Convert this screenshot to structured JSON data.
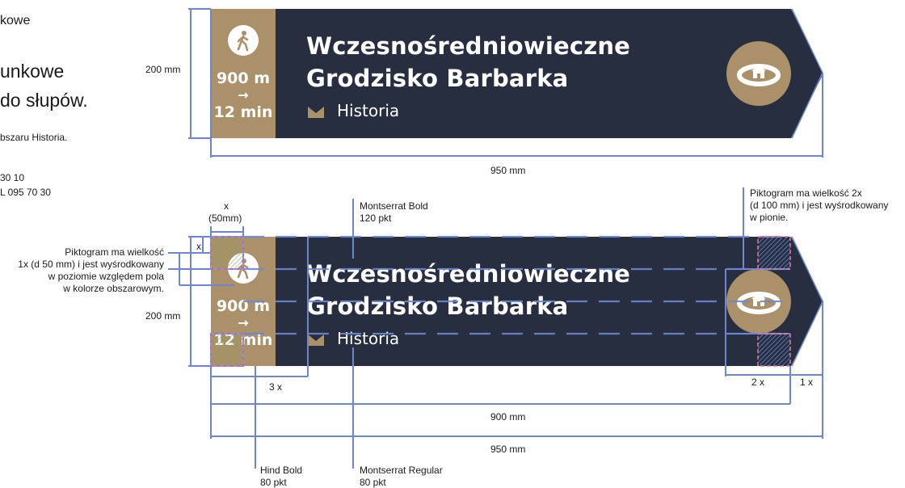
{
  "left_text": {
    "line1": "kowe",
    "line2": "unkowe",
    "line3": "do słupów.",
    "line4": "bszaru Historia.",
    "line5": "30 10",
    "line6": "L 095 70 30"
  },
  "sign": {
    "distance": "900 m",
    "arrow": "→",
    "time": "12 min",
    "title_line1": "Wczesnośredniowieczne",
    "title_line2": "Grodzisko Barbarka",
    "category": "Historia",
    "walker_icon": "pedestrian-icon",
    "category_icon": "crown-icon",
    "pictogram_icon": "fortified-settlement-icon",
    "colors": {
      "navy": "#262e40",
      "gold": "#ab9169",
      "guide": "#6e86cf",
      "margin": "#e07aa0"
    }
  },
  "annotations": {
    "height_top": "200 mm",
    "height_bottom": "200 mm",
    "width_950_top": "950 mm",
    "width_900": "900 mm",
    "width_950_bottom": "950 mm",
    "x_label": "x",
    "x_size": "(50mm)",
    "x_small": "x",
    "three_x": "3 x",
    "two_x": "2 x",
    "one_x": "1 x",
    "font_title_name": "Montserrat Bold",
    "font_title_size": "120 pkt",
    "font_dist_name": "Hind Bold",
    "font_dist_size": "80 pkt",
    "font_cat_name": "Montserrat Regular",
    "font_cat_size": "80 pkt",
    "pict_small_1": "Piktogram ma wielkość",
    "pict_small_2": "1x (d 50 mm) i jest wyśrodkowany",
    "pict_small_3": "w poziomie względem pola",
    "pict_small_4": "w kolorze obszarowym.",
    "pict_big_1": "Piktogram ma wielkość 2x",
    "pict_big_2": "(d 100 mm) i jest wyśrodkowany",
    "pict_big_3": "w pionie."
  }
}
